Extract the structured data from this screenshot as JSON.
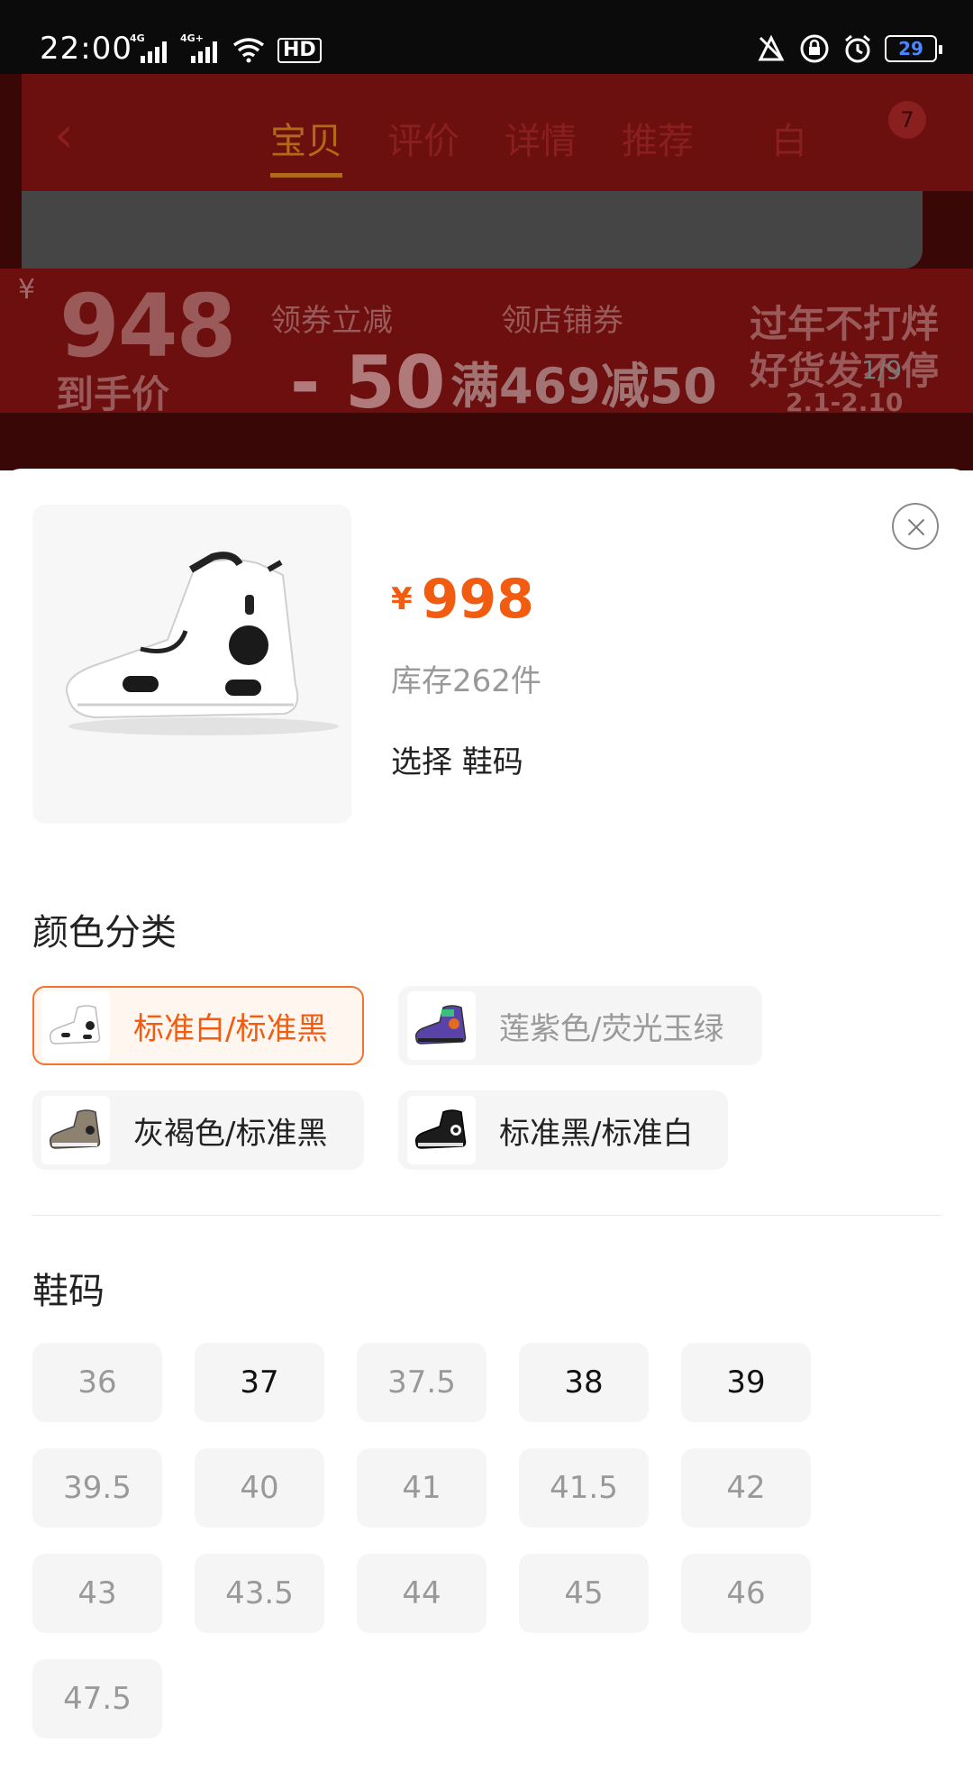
{
  "status_bar": {
    "time": "22:00",
    "net1": "4G",
    "net2": "4G+",
    "hd_label": "HD",
    "battery": "29"
  },
  "background_page": {
    "tabs": [
      "宝贝",
      "评价",
      "详情",
      "推荐"
    ],
    "active_tab": "宝贝",
    "color_label": "白",
    "cart_count": "7",
    "yen": "¥",
    "final_price": "948",
    "final_price_label": "到手价",
    "coupon_label": "领券立减",
    "coupon_value": "- 50",
    "shop_coupon_label": "领店铺券",
    "shop_coupon_value": "满469减50",
    "promo_line1": "过年不打烊",
    "promo_line2": "好货发不停",
    "promo_dates": "2.1-2.10",
    "image_page": "1/9"
  },
  "product": {
    "currency": "¥",
    "price": "998",
    "stock": "库存262件",
    "select_tip": "选择 鞋码"
  },
  "color_section": {
    "title": "颜色分类",
    "options": [
      {
        "label": "标准白/标准黑",
        "state": "selected"
      },
      {
        "label": "莲紫色/荧光玉绿",
        "state": "disabled"
      },
      {
        "label": "灰褐色/标准黑",
        "state": "available"
      },
      {
        "label": "标准黑/标准白",
        "state": "available"
      }
    ]
  },
  "size_section": {
    "title": "鞋码",
    "sizes": [
      {
        "label": "36",
        "available": false
      },
      {
        "label": "37",
        "available": true
      },
      {
        "label": "37.5",
        "available": false
      },
      {
        "label": "38",
        "available": true
      },
      {
        "label": "39",
        "available": true
      },
      {
        "label": "39.5",
        "available": false
      },
      {
        "label": "40",
        "available": false
      },
      {
        "label": "41",
        "available": false
      },
      {
        "label": "41.5",
        "available": false
      },
      {
        "label": "42",
        "available": false
      },
      {
        "label": "43",
        "available": false
      },
      {
        "label": "43.5",
        "available": false
      },
      {
        "label": "44",
        "available": false
      },
      {
        "label": "45",
        "available": false
      },
      {
        "label": "46",
        "available": false
      },
      {
        "label": "47.5",
        "available": false
      }
    ]
  },
  "colors": {
    "accent": "#f25c11",
    "selected_border": "#f2742f"
  },
  "icons": {
    "close": "close-icon",
    "wifi": "wifi-icon",
    "alarm": "alarm-icon",
    "lock": "rotation-lock-icon",
    "mute": "vibrate-icon"
  }
}
